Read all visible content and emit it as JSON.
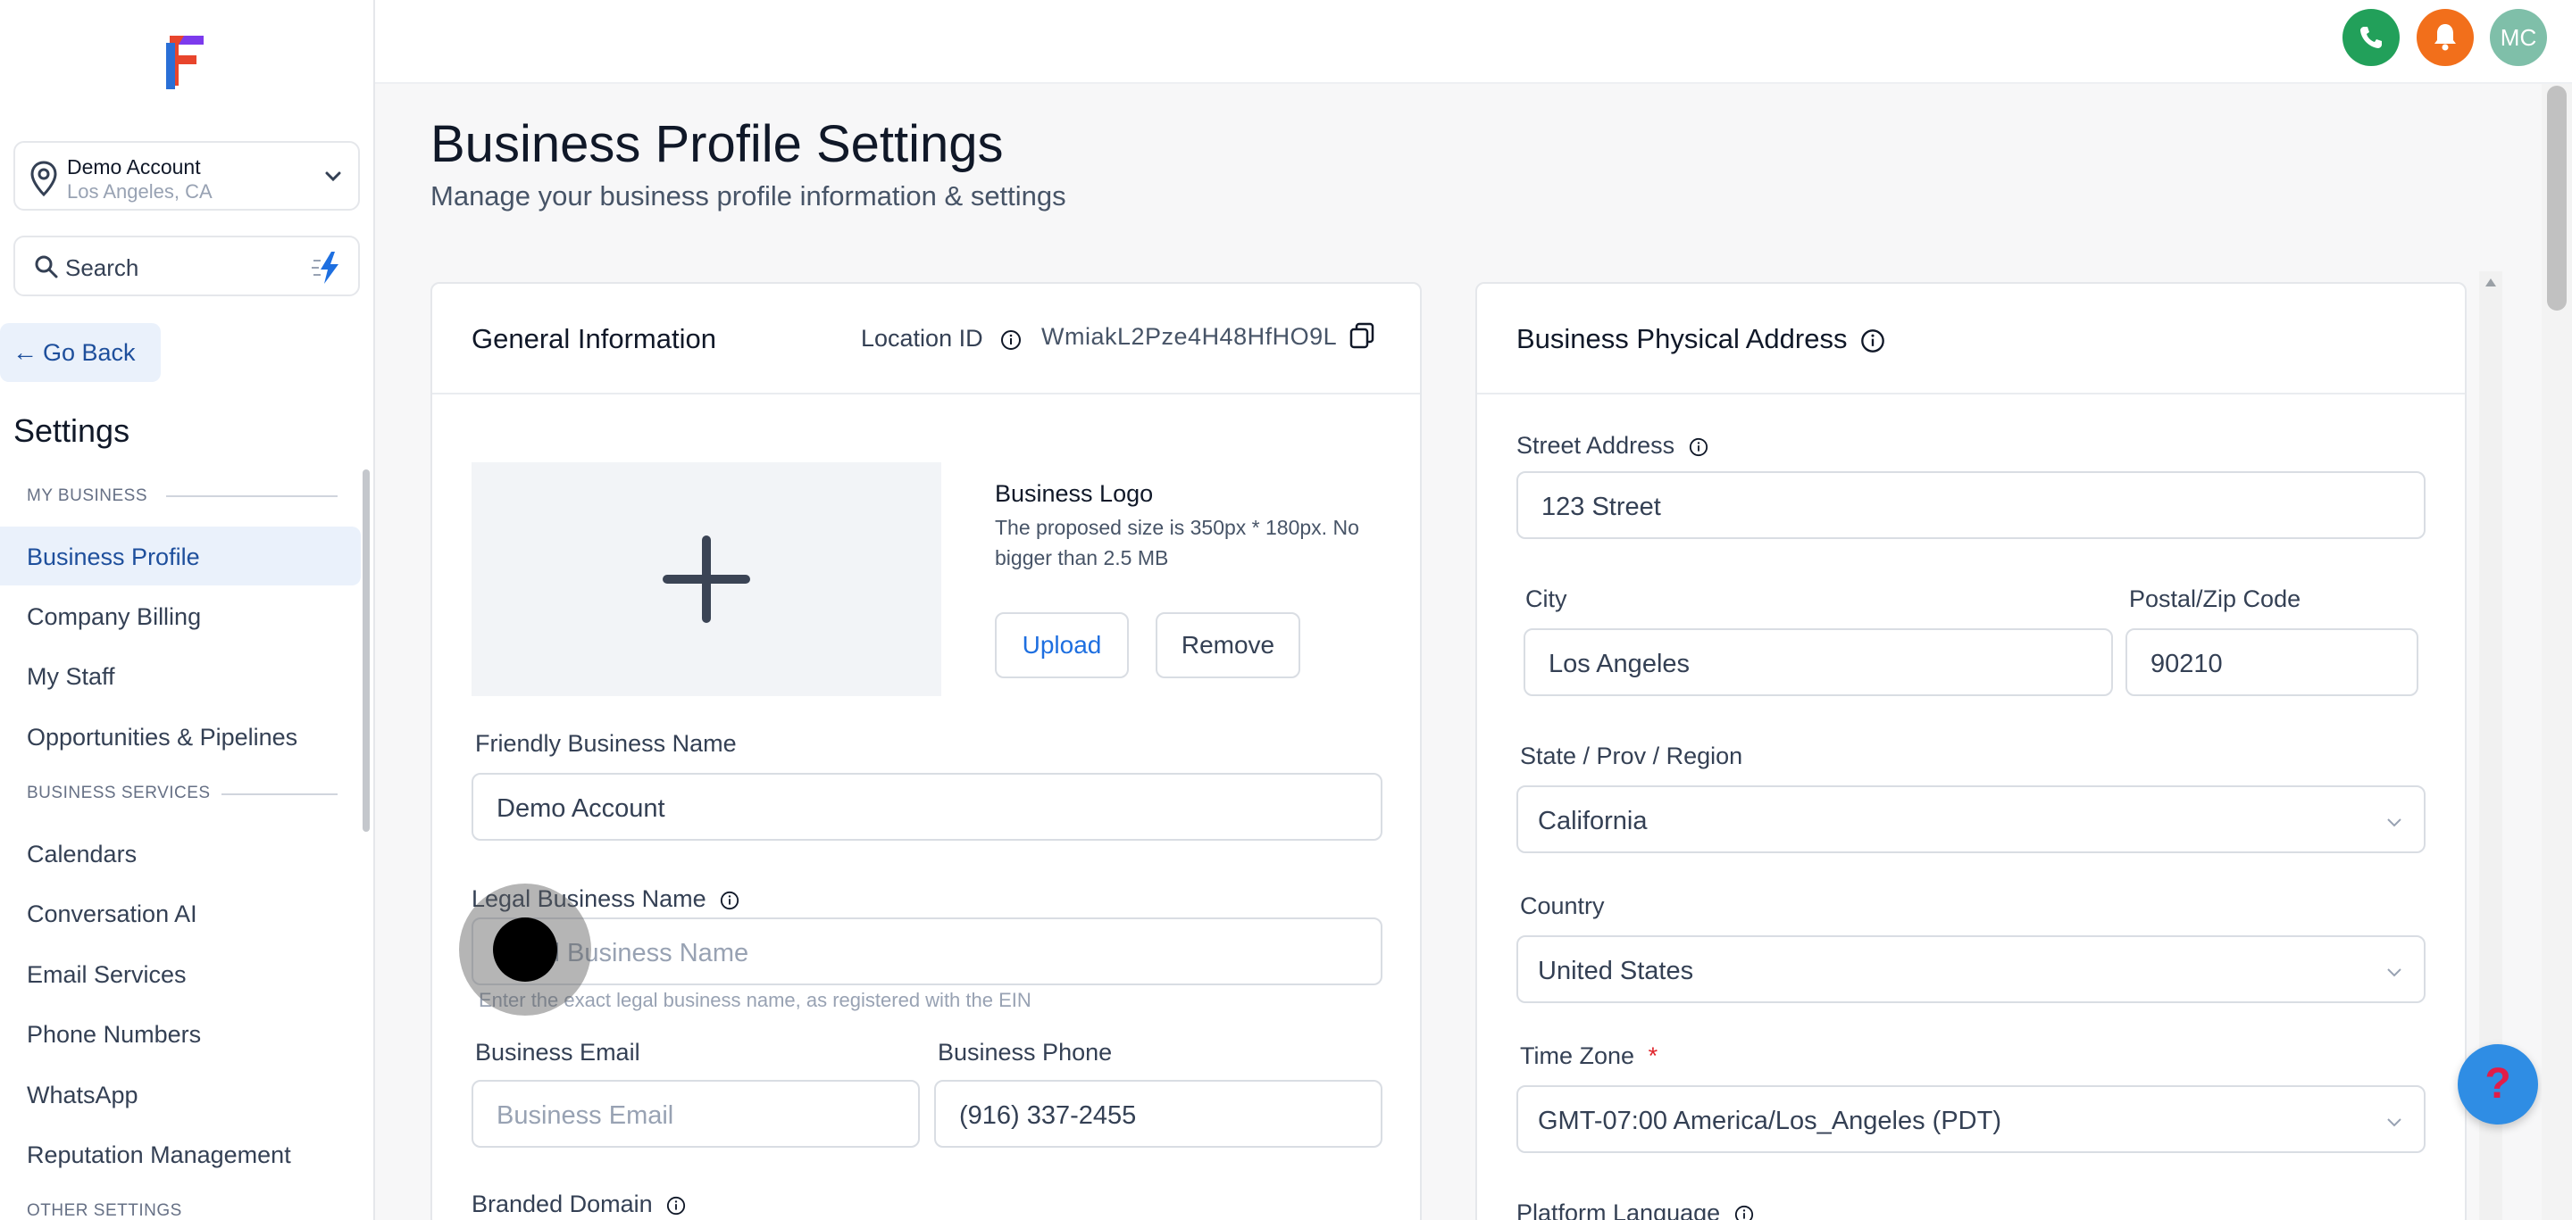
{
  "sidebar": {
    "account": {
      "name": "Demo Account",
      "location": "Los Angeles, CA"
    },
    "search": {
      "label": "Search"
    },
    "go_back": "Go Back",
    "settings_title": "Settings",
    "sections": [
      {
        "label": "MY BUSINESS"
      },
      {
        "label": "BUSINESS SERVICES"
      },
      {
        "label": "OTHER SETTINGS"
      }
    ],
    "items": [
      {
        "label": "Business Profile"
      },
      {
        "label": "Company Billing"
      },
      {
        "label": "My Staff"
      },
      {
        "label": "Opportunities & Pipelines"
      },
      {
        "label": "Calendars"
      },
      {
        "label": "Conversation AI"
      },
      {
        "label": "Email Services"
      },
      {
        "label": "Phone Numbers"
      },
      {
        "label": "WhatsApp"
      },
      {
        "label": "Reputation Management"
      }
    ]
  },
  "topbar": {
    "avatar_initials": "MC",
    "colors": {
      "phone": "#22a05a",
      "bell": "#f26f1b",
      "avatar": "#7fbfa9"
    }
  },
  "page": {
    "title": "Business Profile Settings",
    "subtitle": "Manage your business profile information & settings"
  },
  "general": {
    "title": "General Information",
    "location_id_label": "Location ID",
    "location_id_value": "WmiakL2Pze4H48HfHO9L",
    "logo_title": "Business Logo",
    "logo_hint": "The proposed size is 350px * 180px. No bigger than 2.5 MB",
    "upload_label": "Upload",
    "remove_label": "Remove",
    "friendly_name_label": "Friendly Business Name",
    "friendly_name_value": "Demo Account",
    "legal_name_label": "Legal Business Name",
    "legal_name_placeholder": "Legal Business Name",
    "legal_name_hint": "Enter the exact legal business name, as registered with the EIN",
    "email_label": "Business Email",
    "email_placeholder": "Business Email",
    "phone_label": "Business Phone",
    "phone_value": "(916) 337-2455",
    "branded_domain_label": "Branded Domain"
  },
  "address": {
    "title": "Business Physical Address",
    "street_label": "Street Address",
    "street_value": "123 Street",
    "city_label": "City",
    "city_value": "Los Angeles",
    "zip_label": "Postal/Zip Code",
    "zip_value": "90210",
    "state_label": "State / Prov / Region",
    "state_value": "California",
    "country_label": "Country",
    "country_value": "United States",
    "timezone_label": "Time Zone",
    "timezone_required": "*",
    "timezone_value": "GMT-07:00 America/Los_Angeles (PDT)",
    "language_label": "Platform Language"
  },
  "help": {
    "glyph": "?"
  }
}
